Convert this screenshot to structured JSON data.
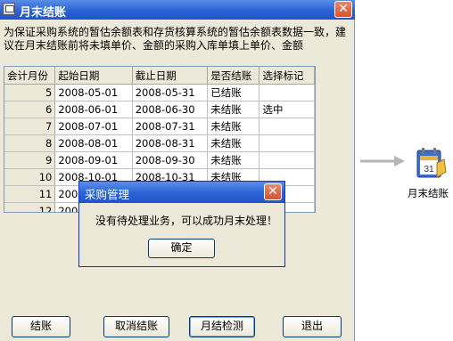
{
  "window": {
    "title": "月末结账",
    "close_glyph": "✕"
  },
  "description": "为保证采购系统的暂估余额表和存货核算系统的暂估余额表数据一致，建议在月末结账前将未填单价、金额的采购入库单填上单价、金额",
  "table": {
    "headers": [
      "会计月份",
      "起始日期",
      "截止日期",
      "是否结账",
      "选择标记"
    ],
    "rows": [
      [
        "5",
        "2008-05-01",
        "2008-05-31",
        "已结账",
        ""
      ],
      [
        "6",
        "2008-06-01",
        "2008-06-30",
        "未结账",
        "选中"
      ],
      [
        "7",
        "2008-07-01",
        "2008-07-31",
        "未结账",
        ""
      ],
      [
        "8",
        "2008-08-01",
        "2008-08-31",
        "未结账",
        ""
      ],
      [
        "9",
        "2008-09-01",
        "2008-09-30",
        "未结账",
        ""
      ],
      [
        "10",
        "2008-10-01",
        "2008-10-31",
        "未结账",
        ""
      ],
      [
        "11",
        "2008",
        "",
        "",
        ""
      ],
      [
        "12",
        "2008",
        "",
        "",
        ""
      ]
    ]
  },
  "buttons": {
    "close_month": "结账",
    "cancel_close": "取消结账",
    "month_check": "月结检测",
    "exit": "退出"
  },
  "popup": {
    "title": "采购管理",
    "message": "没有待处理业务，可以成功月末处理！",
    "ok_label": "确定"
  },
  "side": {
    "icon": "calendar-icon",
    "label": "月末结账"
  },
  "colors": {
    "titlebar": "#2a62d6",
    "background": "#ece9d8",
    "arrow": "#b5b5b5"
  }
}
